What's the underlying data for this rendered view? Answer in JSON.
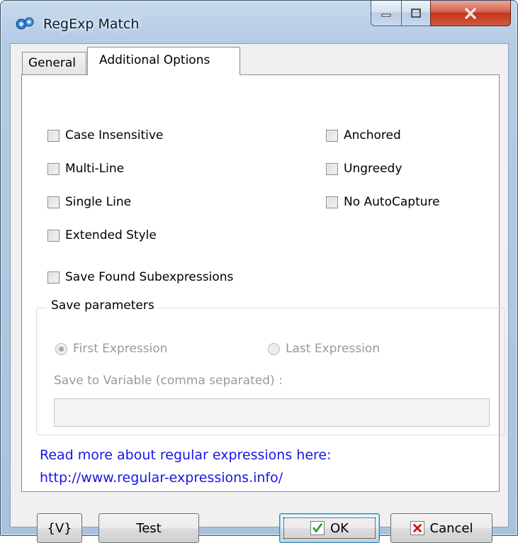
{
  "window": {
    "title": "RegExp Match"
  },
  "tabs": [
    {
      "label": "General"
    },
    {
      "label": "Additional Options"
    }
  ],
  "options": {
    "case_insensitive": "Case Insensitive",
    "multi_line": "Multi-Line",
    "single_line": "Single Line",
    "extended_style": "Extended Style",
    "anchored": "Anchored",
    "ungreedy": "Ungreedy",
    "no_autocapture": "No AutoCapture",
    "save_found": "Save Found Subexpressions"
  },
  "save_params": {
    "title": "Save parameters",
    "first_expression": "First Expression",
    "last_expression": "Last Expression",
    "selected": "First Expression",
    "variable_label": "Save to Variable (comma separated) :",
    "variable_value": ""
  },
  "info": {
    "line1": "Read more about regular expressions here:",
    "line2": "http://www.regular-expressions.info/"
  },
  "buttons": {
    "variable": "{V}",
    "test": "Test",
    "ok": "OK",
    "cancel": "Cancel"
  },
  "colors": {
    "link": "#1a14e6",
    "ok_icon": "#2f9a2f",
    "cancel_icon": "#d01010"
  }
}
